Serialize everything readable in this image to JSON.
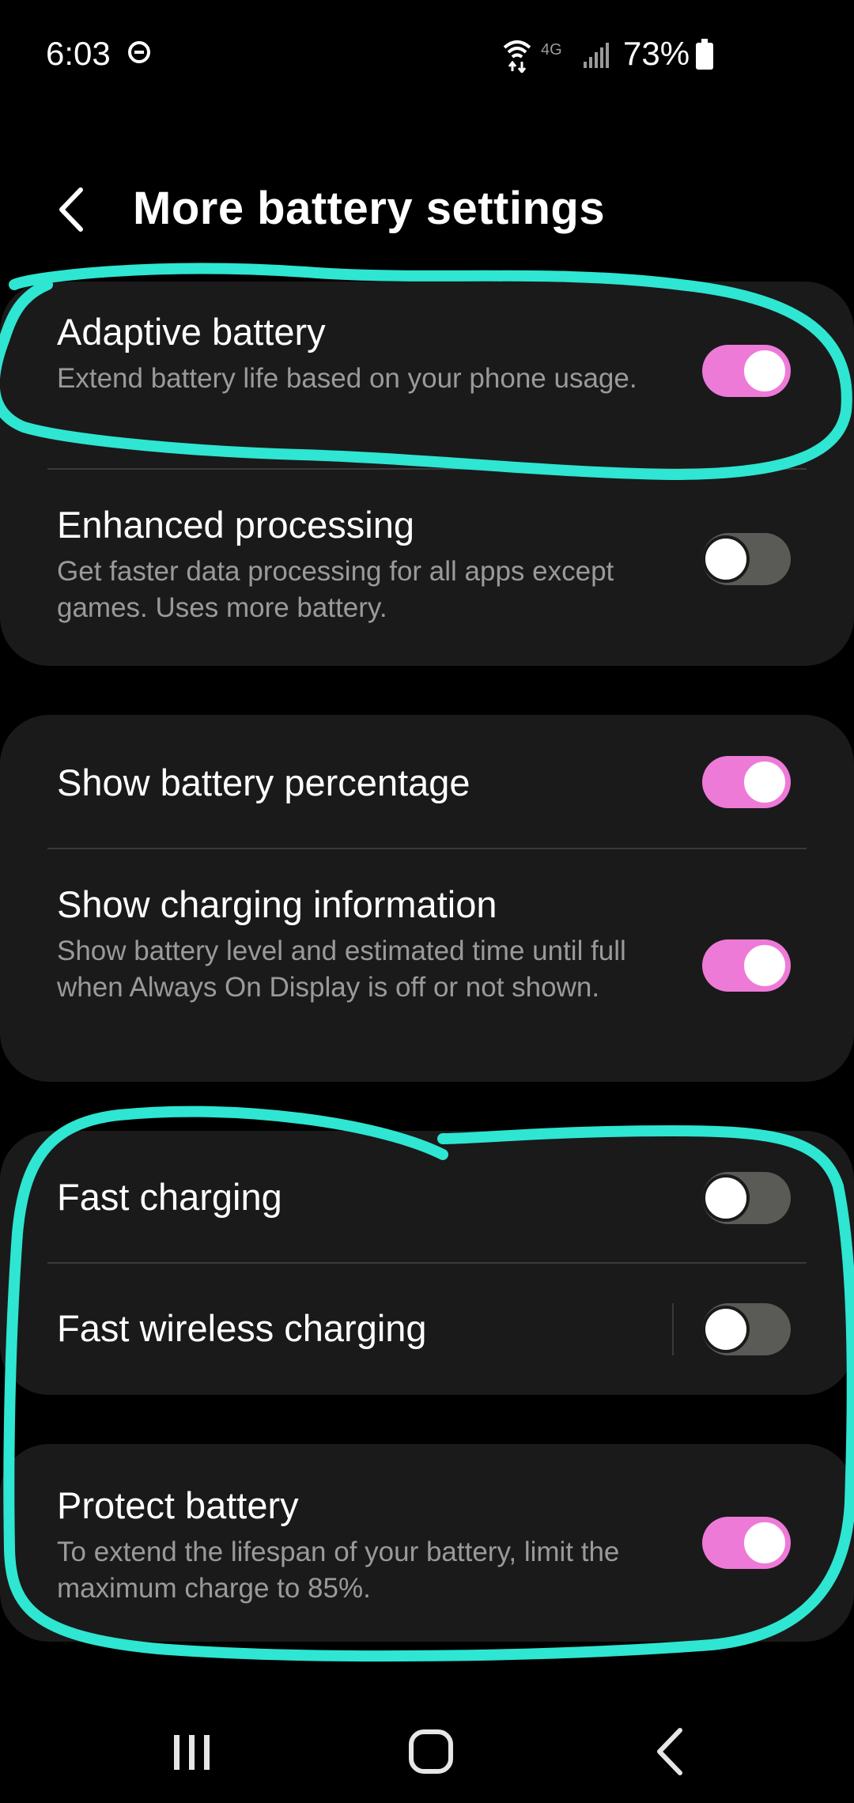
{
  "status_bar": {
    "time": "6:03",
    "network_label": "4G",
    "battery_percent": "73%",
    "icons": [
      "do-not-disturb-icon",
      "wifi-icon",
      "signal-icon",
      "battery-icon"
    ]
  },
  "header": {
    "title": "More battery settings",
    "back_icon": "chevron-left-icon"
  },
  "settings": {
    "adaptive_battery": {
      "title": "Adaptive battery",
      "subtitle": "Extend battery life based on your phone usage.",
      "enabled": true
    },
    "enhanced_processing": {
      "title": "Enhanced processing",
      "subtitle": "Get faster data processing for all apps except games. Uses more battery.",
      "enabled": false
    },
    "show_battery_percentage": {
      "title": "Show battery percentage",
      "enabled": true
    },
    "show_charging_information": {
      "title": "Show charging information",
      "subtitle": "Show battery level and estimated time until full when Always On Display is off or not shown.",
      "enabled": true
    },
    "fast_charging": {
      "title": "Fast charging",
      "enabled": false
    },
    "fast_wireless_charging": {
      "title": "Fast wireless charging",
      "enabled": false
    },
    "protect_battery": {
      "title": "Protect battery",
      "subtitle": "To extend the lifespan of your battery, limit the maximum charge to 85%.",
      "enabled": true
    }
  },
  "nav_bar": {
    "items": [
      "recent-apps-icon",
      "home-icon",
      "back-icon"
    ]
  },
  "colors": {
    "toggle_on": "#ee7ad8",
    "toggle_off": "#5a5a56",
    "card_background": "#1a1a1a",
    "annotation": "#2ee6d2"
  }
}
